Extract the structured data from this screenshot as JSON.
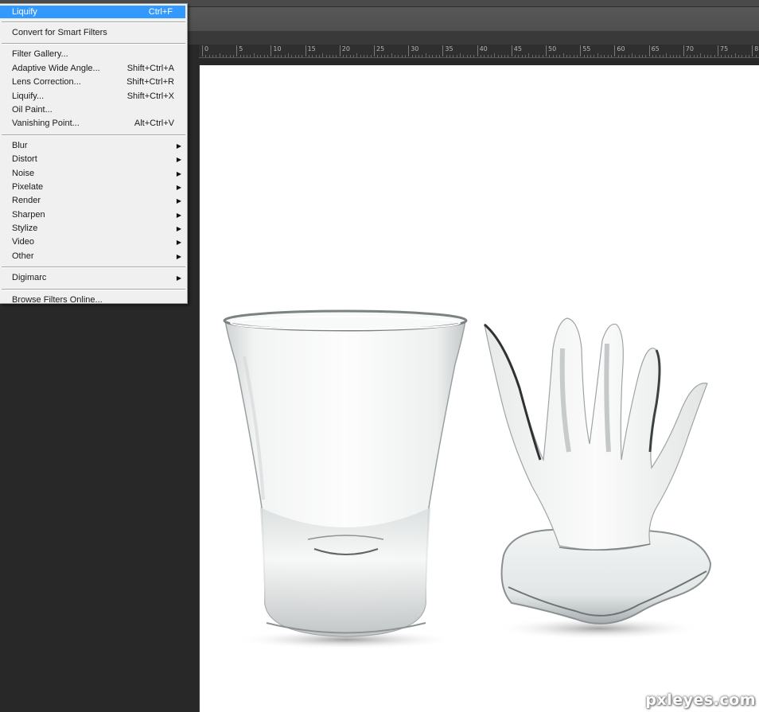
{
  "filter_menu": {
    "last_filter": {
      "label": "Liquify",
      "shortcut": "Ctrl+F"
    },
    "convert_smart": {
      "label": "Convert for Smart Filters"
    },
    "group_1": [
      {
        "label": "Filter Gallery...",
        "shortcut": ""
      },
      {
        "label": "Adaptive Wide Angle...",
        "shortcut": "Shift+Ctrl+A"
      },
      {
        "label": "Lens Correction...",
        "shortcut": "Shift+Ctrl+R"
      },
      {
        "label": "Liquify...",
        "shortcut": "Shift+Ctrl+X"
      },
      {
        "label": "Oil Paint...",
        "shortcut": ""
      },
      {
        "label": "Vanishing Point...",
        "shortcut": "Alt+Ctrl+V"
      }
    ],
    "submenus": [
      {
        "label": "Blur"
      },
      {
        "label": "Distort"
      },
      {
        "label": "Noise"
      },
      {
        "label": "Pixelate"
      },
      {
        "label": "Render"
      },
      {
        "label": "Sharpen"
      },
      {
        "label": "Stylize"
      },
      {
        "label": "Video"
      },
      {
        "label": "Other"
      }
    ],
    "plugins": [
      {
        "label": "Digimarc"
      }
    ],
    "browse_online": {
      "label": "Browse Filters Online..."
    },
    "submenu_arrow": "▶",
    "highlight_color": "#3399ff"
  },
  "ruler": {
    "labels": [
      "0",
      "5",
      "10",
      "15",
      "20",
      "25",
      "30",
      "35",
      "40",
      "45",
      "50",
      "55",
      "60",
      "65",
      "70",
      "75",
      "8"
    ]
  },
  "canvas": {
    "objects": [
      "shot-glass",
      "liquified-glass-hand"
    ],
    "background": "#ffffff"
  },
  "watermark": {
    "text": "pxleyes.com"
  }
}
